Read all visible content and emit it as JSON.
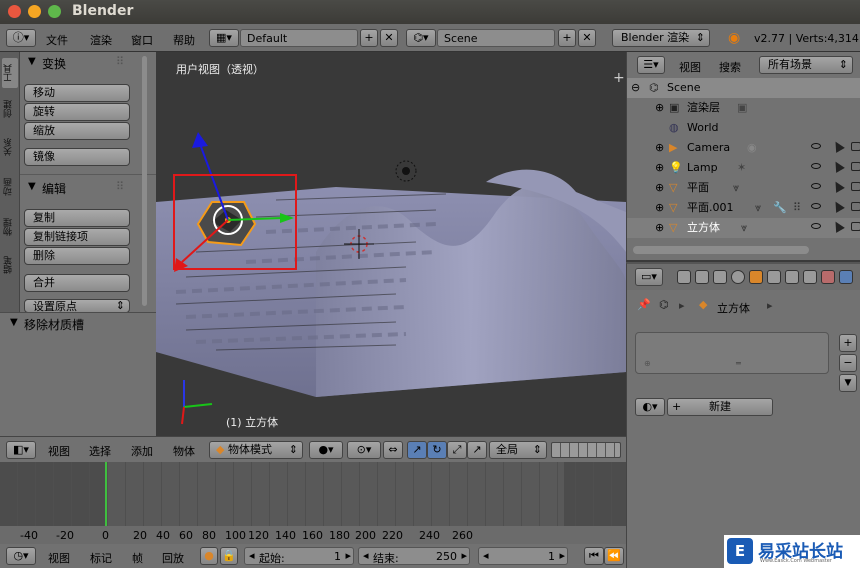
{
  "window": {
    "title": "Blender"
  },
  "topbar": {
    "menus": [
      "文件",
      "渲染",
      "窗口",
      "帮助"
    ],
    "layout_name": "Default",
    "scene_name": "Scene",
    "render_engine": "Blender 渲染",
    "stats": "v2.77 | Verts:4,314"
  },
  "tool_tabs": [
    "工具",
    "创建",
    "关系",
    "动画",
    "物理",
    "蜡笔"
  ],
  "toolshelf": {
    "transform_title": "变换",
    "move": "移动",
    "rotate": "旋转",
    "scale": "缩放",
    "mirror": "镜像",
    "edit_title": "编辑",
    "duplicate": "复制",
    "duplicate_linked": "复制链接项",
    "delete": "删除",
    "join": "合并",
    "set_origin": "设置原点"
  },
  "operator_panel": {
    "title": "移除材质槽"
  },
  "viewport": {
    "view_label": "用户视图（透视）",
    "object_label": "(1) 立方体"
  },
  "viewport_header": {
    "menus": [
      "视图",
      "选择",
      "添加",
      "物体"
    ],
    "mode": "物体模式",
    "orientation": "全局"
  },
  "timeline": {
    "ticks": [
      "-40",
      "-20",
      "0",
      "20",
      "40",
      "60",
      "80",
      "100",
      "120",
      "140",
      "160",
      "180",
      "200",
      "220",
      "240",
      "260"
    ],
    "current_frame_value": 0,
    "menus": [
      "视图",
      "标记",
      "帧",
      "回放"
    ],
    "start_label": "起始:",
    "start_value": "1",
    "end_label": "结束:",
    "end_value": "250",
    "frame_value": "1"
  },
  "outliner": {
    "menus": [
      "视图",
      "搜索"
    ],
    "filter": "所有场景",
    "items": [
      "Scene",
      "渲染层",
      "World",
      "Camera",
      "Lamp",
      "平面",
      "平面.001",
      "立方体"
    ]
  },
  "properties": {
    "breadcrumb_object": "立方体",
    "new_button": "新建"
  },
  "watermark": {
    "text": "易采站长站",
    "subtext": "Www.Easck.Com  Webmaster"
  }
}
